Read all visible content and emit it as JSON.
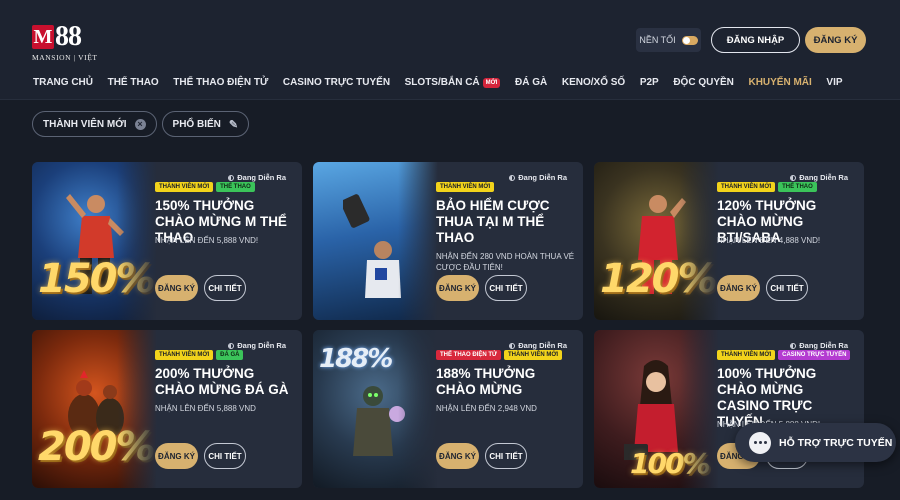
{
  "logo": {
    "mark": "M",
    "number": "88",
    "subtitle": "MANSION | VIỆT"
  },
  "header": {
    "dark_mode_label": "NỀN TỐI",
    "login_label": "ĐĂNG NHẬP",
    "register_label": "ĐĂNG KÝ"
  },
  "nav": {
    "items": [
      {
        "label": "TRANG CHỦ"
      },
      {
        "label": "THỂ THAO"
      },
      {
        "label": "THỂ THAO ĐIỆN TỬ"
      },
      {
        "label": "CASINO TRỰC TUYẾN"
      },
      {
        "label": "SLOTS/BẮN CÁ",
        "badge": "MỚI"
      },
      {
        "label": "ĐÁ GÀ"
      },
      {
        "label": "KENO/XỔ SỐ"
      },
      {
        "label": "P2P"
      },
      {
        "label": "ĐỘC QUYỀN"
      },
      {
        "label": "KHUYẾN MÃI",
        "active": true
      },
      {
        "label": "VIP"
      }
    ]
  },
  "filters": {
    "chip1": "THÀNH VIÊN MỚI",
    "chip2": "PHỔ BIẾN"
  },
  "colors": {
    "accent_gold": "#d7b16f",
    "background": "#171c26",
    "card": "#262d3c",
    "tag_yellow": "#f2d31b",
    "tag_green": "#3bc45a",
    "tag_red": "#d8283c",
    "tag_purple": "#b43bd1"
  },
  "cards": [
    {
      "status": "Đang Diễn Ra",
      "tags": [
        {
          "text": "THÀNH VIÊN MỚI",
          "color": "yellow"
        },
        {
          "text": "THỂ THAO",
          "color": "green"
        }
      ],
      "title": "150% THƯỞNG CHÀO MỪNG M THỂ THAO",
      "subtitle": "NHẬN LÊN ĐẾN 5,888 VND!",
      "art_percent": "150%",
      "register": "ĐĂNG KÝ",
      "details": "CHI TIẾT"
    },
    {
      "status": "Đang Diễn Ra",
      "tags": [
        {
          "text": "THÀNH VIÊN MỚI",
          "color": "yellow"
        }
      ],
      "title": "BẢO HIỂM CƯỢC THUA TẠI M THỂ THAO",
      "subtitle": "NHẬN ĐẾN 280 VND HOÀN THUA VÉ CƯỢC ĐẦU TIÊN!",
      "art_percent": "",
      "register": "ĐĂNG KÝ",
      "details": "CHI TIẾT"
    },
    {
      "status": "Đang Diễn Ra",
      "tags": [
        {
          "text": "THÀNH VIÊN MỚI",
          "color": "yellow"
        },
        {
          "text": "THỂ THAO",
          "color": "green"
        }
      ],
      "title": "120% THƯỞNG CHÀO MỪNG BTI/SABA",
      "subtitle": "NHẬN LÊN ĐẾN 4,888 VND!",
      "art_percent": "120%",
      "register": "ĐĂNG KÝ",
      "details": "CHI TIẾT"
    },
    {
      "status": "Đang Diễn Ra",
      "tags": [
        {
          "text": "THÀNH VIÊN MỚI",
          "color": "yellow"
        },
        {
          "text": "ĐÁ GÀ",
          "color": "green"
        }
      ],
      "title": "200% THƯỞNG CHÀO MỪNG ĐÁ GÀ",
      "subtitle": "NHẬN LÊN ĐẾN 5,888 VND",
      "art_percent": "200%",
      "register": "ĐĂNG KÝ",
      "details": "CHI TIẾT"
    },
    {
      "status": "Đang Diễn Ra",
      "tags": [
        {
          "text": "THỂ THAO ĐIỆN TỬ",
          "color": "red"
        },
        {
          "text": "THÀNH VIÊN MỚI",
          "color": "yellow"
        }
      ],
      "title": "188% THƯỞNG CHÀO MỪNG",
      "subtitle": "NHẬN LÊN ĐẾN 2,948 VND",
      "art_percent": "188%",
      "register": "ĐĂNG KÝ",
      "details": "CHI TIẾT"
    },
    {
      "status": "Đang Diễn Ra",
      "tags": [
        {
          "text": "THÀNH VIÊN MỚI",
          "color": "yellow"
        },
        {
          "text": "CASINO TRỰC TUYẾN",
          "color": "purple"
        }
      ],
      "title": "100% THƯỞNG CHÀO MỪNG CASINO TRỰC TUYẾN",
      "subtitle": "NHẬN LÊN ĐẾN 5,888 VND!",
      "art_percent": "100%",
      "register": "ĐĂNG KÝ",
      "details": "CHI TIẾT"
    }
  ],
  "support": {
    "label": "HỖ TRỢ TRỰC TUYẾN"
  }
}
